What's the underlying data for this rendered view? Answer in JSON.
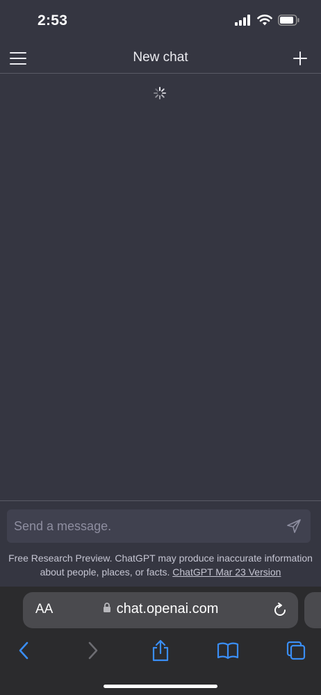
{
  "status_bar": {
    "time": "2:53",
    "icons": [
      "cellular-signal-icon",
      "wifi-icon",
      "battery-icon"
    ]
  },
  "header": {
    "title": "New chat",
    "menu_icon": "hamburger-menu-icon",
    "new_chat_icon": "plus-icon"
  },
  "main": {
    "loading_icon": "spinner-icon"
  },
  "composer": {
    "placeholder": "Send a message.",
    "send_icon": "send-icon"
  },
  "disclaimer": {
    "text": "Free Research Preview. ChatGPT may produce inaccurate information about people, places, or facts.",
    "link_label": "ChatGPT Mar 23 Version"
  },
  "browser": {
    "text_size_label": "AA",
    "url": "chat.openai.com",
    "lock_icon": "lock-icon",
    "reload_icon": "reload-icon",
    "toolbar_icons": [
      "back-icon",
      "forward-icon",
      "share-icon",
      "bookmarks-icon",
      "tabs-icon"
    ]
  },
  "colors": {
    "background": "#353641",
    "input_background": "#40414f",
    "browser_background": "#2b2b2d",
    "url_bar_background": "#4a4a4e",
    "accent_blue": "#3a8ef6"
  }
}
